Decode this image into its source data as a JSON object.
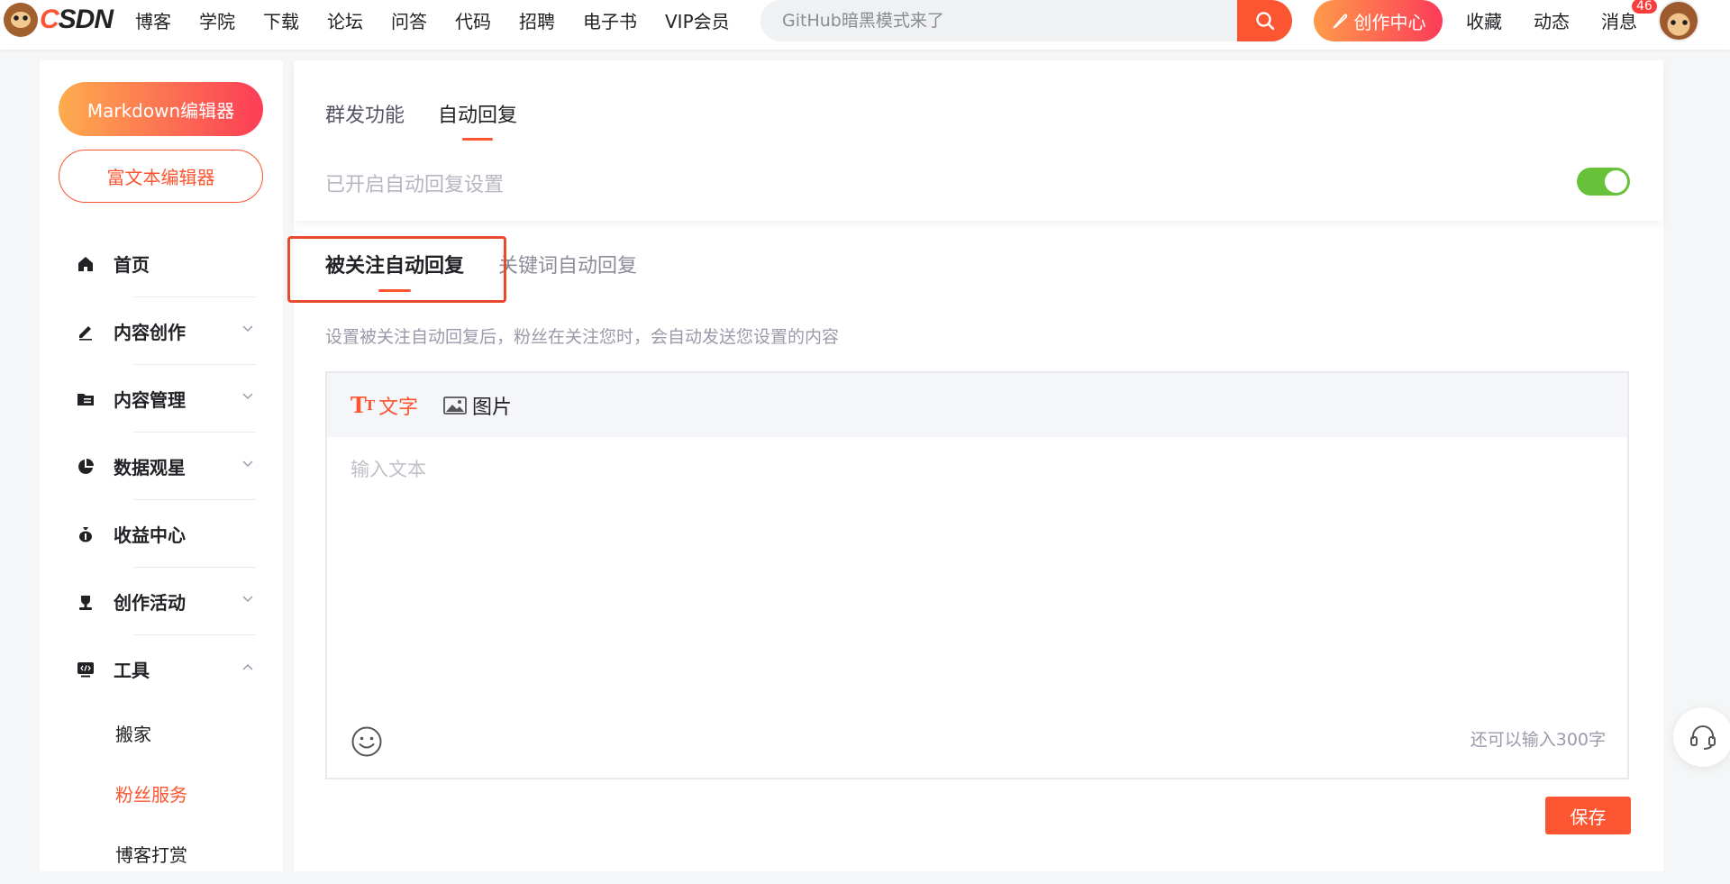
{
  "brand": {
    "logo_text": "CSDN",
    "accent_color": "#fc5531"
  },
  "topnav": {
    "items": [
      "博客",
      "学院",
      "下载",
      "论坛",
      "问答",
      "代码",
      "招聘",
      "电子书",
      "VIP会员"
    ],
    "search_placeholder": "GitHub暗黑模式来了",
    "search_icon": "search-icon",
    "create_label": "创作中心",
    "right_items": [
      "收藏",
      "动态",
      "消息"
    ],
    "message_badge": "46"
  },
  "sidebar": {
    "markdown_button": "Markdown编辑器",
    "richtext_button": "富文本编辑器",
    "menu": [
      {
        "label": "首页",
        "icon": "home-icon",
        "chevron": ""
      },
      {
        "label": "内容创作",
        "icon": "pen-icon",
        "chevron": "down"
      },
      {
        "label": "内容管理",
        "icon": "folder-icon",
        "chevron": "down"
      },
      {
        "label": "数据观星",
        "icon": "pie-chart-icon",
        "chevron": "down"
      },
      {
        "label": "收益中心",
        "icon": "money-bag-icon",
        "chevron": ""
      },
      {
        "label": "创作活动",
        "icon": "trophy-icon",
        "chevron": "down"
      },
      {
        "label": "工具",
        "icon": "code-tool-icon",
        "chevron": "up"
      }
    ],
    "sub_items": [
      "搬家",
      "粉丝服务",
      "博客打赏"
    ],
    "active_sub": "粉丝服务"
  },
  "main": {
    "tabs": [
      "群发功能",
      "自动回复"
    ],
    "active_tab": "自动回复",
    "setting_label": "已开启自动回复设置",
    "auto_reply_enabled": true,
    "subtabs": [
      "被关注自动回复",
      "关键词自动回复"
    ],
    "active_subtab": "被关注自动回复",
    "description": "设置被关注自动回复后，粉丝在关注您时，会自动发送您设置的内容",
    "editor": {
      "tools": [
        "文字",
        "图片"
      ],
      "active_tool": "文字",
      "placeholder": "输入文本",
      "value": "",
      "remaining": "还可以输入300字"
    },
    "save_label": "保存"
  }
}
